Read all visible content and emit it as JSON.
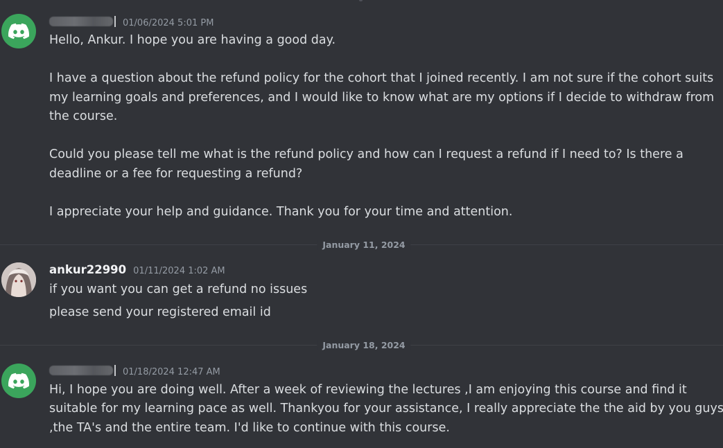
{
  "messages": [
    {
      "author": "",
      "timestamp": "01/06/2024 5:01 PM",
      "lines": [
        "Hello,  Ankur. I hope you are having a good day.",
        "I have a question about the refund policy for the cohort that I joined recently. I am not sure if the cohort suits",
        "my learning goals and preferences, and I would like to know what are my options if I decide to withdraw from",
        "the course.",
        "Could you please tell me what is the refund policy and how can I request a refund if I need to? Is there a",
        "deadline or a fee for requesting a refund?",
        "I appreciate your help and guidance. Thank you for your time and attention."
      ]
    },
    {
      "author": "ankur22990",
      "timestamp": "01/11/2024 1:02 AM",
      "lines": [
        "if you want you can get a refund no issues",
        "please send your registered email id"
      ]
    },
    {
      "author": "",
      "timestamp": "01/18/2024 12:47 AM",
      "lines": [
        "Hi, I hope you are doing well. After a week of reviewing the lectures ,I am enjoying this course and find it",
        "suitable for my learning pace as well. Thankyou for your assistance, I really appreciate the the aid by you guys",
        ",the TA's and the entire team. I'd  like to continue with this course."
      ]
    }
  ],
  "dividers": [
    "January 11, 2024",
    "January 18, 2024"
  ],
  "colors": {
    "background": "#313338",
    "discord_avatar": "#3ba55c",
    "text": "#dbdee1",
    "muted": "#949ba4"
  }
}
